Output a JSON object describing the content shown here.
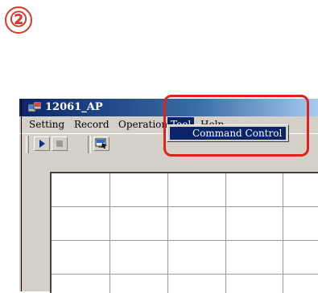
{
  "step_badge": "②",
  "window": {
    "title": "12061_AP",
    "icon": "app-icon"
  },
  "menubar": {
    "items": [
      "Setting",
      "Record",
      "Operation",
      "Tool",
      "Help"
    ],
    "active": "Tool"
  },
  "tool_menu": {
    "items": [
      "Command Control"
    ],
    "selected": "Command Control"
  },
  "toolbar": {
    "buttons": [
      "play-icon",
      "stop-icon",
      "monitor-icon"
    ]
  },
  "colors": {
    "highlight": "#e0221b",
    "title_bar": "#0a246a",
    "menu_selection": "#0a246a"
  }
}
